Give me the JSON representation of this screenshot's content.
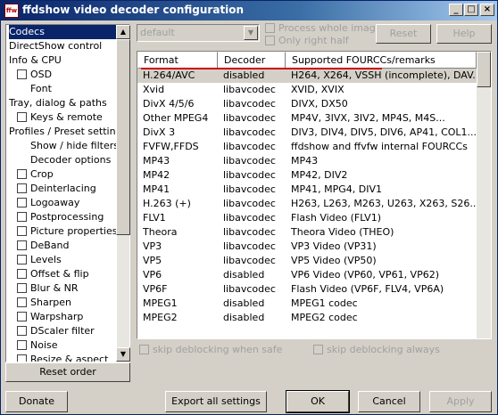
{
  "window": {
    "title": "ffdshow video decoder configuration",
    "icon_label": "ffw",
    "buttons": [
      "_",
      "□",
      "×"
    ]
  },
  "sidebar": {
    "items": [
      {
        "label": "Codecs",
        "selected": true,
        "checkbox": false,
        "indent": 0
      },
      {
        "label": "DirectShow control",
        "checkbox": false,
        "indent": 0
      },
      {
        "label": "Info & CPU",
        "checkbox": false,
        "indent": 0
      },
      {
        "label": "OSD",
        "checkbox": true,
        "indent": 1
      },
      {
        "label": "Font",
        "checkbox": false,
        "indent": 2
      },
      {
        "label": "Tray, dialog & paths",
        "checkbox": false,
        "indent": 0
      },
      {
        "label": "Keys & remote",
        "checkbox": true,
        "indent": 1
      },
      {
        "label": "Profiles / Preset settings",
        "checkbox": false,
        "indent": 0
      },
      {
        "label": "Show / hide filters",
        "checkbox": false,
        "indent": 2
      },
      {
        "label": "Decoder options",
        "checkbox": false,
        "indent": 2
      },
      {
        "label": "Crop",
        "checkbox": true,
        "indent": 1
      },
      {
        "label": "Deinterlacing",
        "checkbox": true,
        "indent": 1
      },
      {
        "label": "Logoaway",
        "checkbox": true,
        "indent": 1
      },
      {
        "label": "Postprocessing",
        "checkbox": true,
        "indent": 1
      },
      {
        "label": "Picture properties",
        "checkbox": true,
        "indent": 1
      },
      {
        "label": "DeBand",
        "checkbox": true,
        "indent": 1
      },
      {
        "label": "Levels",
        "checkbox": true,
        "indent": 1
      },
      {
        "label": "Offset & flip",
        "checkbox": true,
        "indent": 1
      },
      {
        "label": "Blur & NR",
        "checkbox": true,
        "indent": 1
      },
      {
        "label": "Sharpen",
        "checkbox": true,
        "indent": 1
      },
      {
        "label": "Warpsharp",
        "checkbox": true,
        "indent": 1
      },
      {
        "label": "DScaler filter",
        "checkbox": true,
        "indent": 1
      },
      {
        "label": "Noise",
        "checkbox": true,
        "indent": 1
      },
      {
        "label": "Resize & aspect",
        "checkbox": true,
        "indent": 1
      }
    ],
    "reset_order": "Reset order"
  },
  "toolbar": {
    "preset": "default",
    "process_whole_image": "Process whole image",
    "only_right_half": "Only right half",
    "reset": "Reset",
    "help": "Help"
  },
  "codec_table": {
    "columns": [
      "Format",
      "Decoder",
      "Supported FOURCCs/remarks"
    ],
    "rows": [
      [
        "H.264/AVC",
        "disabled",
        "H264, X264, VSSH (incomplete), DAV..."
      ],
      [
        "Xvid",
        "libavcodec",
        "XVID, XVIX"
      ],
      [
        "DivX 4/5/6",
        "libavcodec",
        "DIVX, DX50"
      ],
      [
        "Other MPEG4",
        "libavcodec",
        "MP4V, 3IVX, 3IV2, MP4S, M4S..."
      ],
      [
        "DivX 3",
        "libavcodec",
        "DIV3, DIV4, DIV5, DIV6, AP41, COL1..."
      ],
      [
        "FVFW,FFDS",
        "libavcodec",
        "ffdshow and ffvfw internal FOURCCs"
      ],
      [
        "MP43",
        "libavcodec",
        "MP43"
      ],
      [
        "MP42",
        "libavcodec",
        "MP42, DIV2"
      ],
      [
        "MP41",
        "libavcodec",
        "MP41, MPG4, DIV1"
      ],
      [
        "H.263 (+)",
        "libavcodec",
        "H263, L263, M263, U263, X263, S26..."
      ],
      [
        "FLV1",
        "libavcodec",
        "Flash Video (FLV1)"
      ],
      [
        "Theora",
        "libavcodec",
        "Theora Video (THEO)"
      ],
      [
        "VP3",
        "libavcodec",
        "VP3 Video (VP31)"
      ],
      [
        "VP5",
        "libavcodec",
        "VP5 Video (VP50)"
      ],
      [
        "VP6",
        "disabled",
        "VP6 Video (VP60, VP61, VP62)"
      ],
      [
        "VP6F",
        "libavcodec",
        "Flash Video (VP6F, FLV4, VP6A)"
      ],
      [
        "MPEG1",
        "disabled",
        "MPEG1 codec"
      ],
      [
        "MPEG2",
        "disabled",
        "MPEG2 codec"
      ]
    ]
  },
  "options": {
    "skip_when_safe": "skip deblocking when safe",
    "skip_always": "skip deblocking always"
  },
  "footer": {
    "donate": "Donate",
    "export": "Export all settings",
    "ok": "OK",
    "cancel": "Cancel",
    "apply": "Apply"
  }
}
